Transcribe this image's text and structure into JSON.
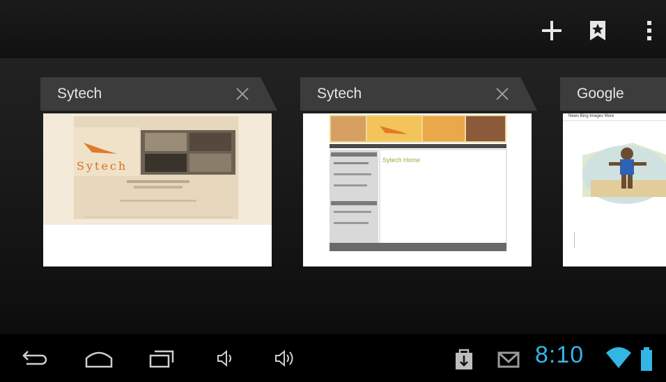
{
  "actionbar": {
    "new_tab_icon": "plus-icon",
    "bookmarks_icon": "bookmark-icon",
    "menu_icon": "overflow-menu-icon"
  },
  "tabs": [
    {
      "title": "Sytech"
    },
    {
      "title": "Sytech"
    },
    {
      "title": "Google"
    }
  ],
  "previews": {
    "sytech_logo": "Sytech",
    "sytech_heading": "Sytech Home",
    "google_links": "News  Bing  Images  More"
  },
  "statusbar": {
    "time": "8:10",
    "accent_color": "#33b5e5"
  },
  "navbar": {
    "icons": [
      "back-icon",
      "home-icon",
      "recent-apps-icon",
      "volume-down-icon",
      "volume-up-icon"
    ]
  }
}
